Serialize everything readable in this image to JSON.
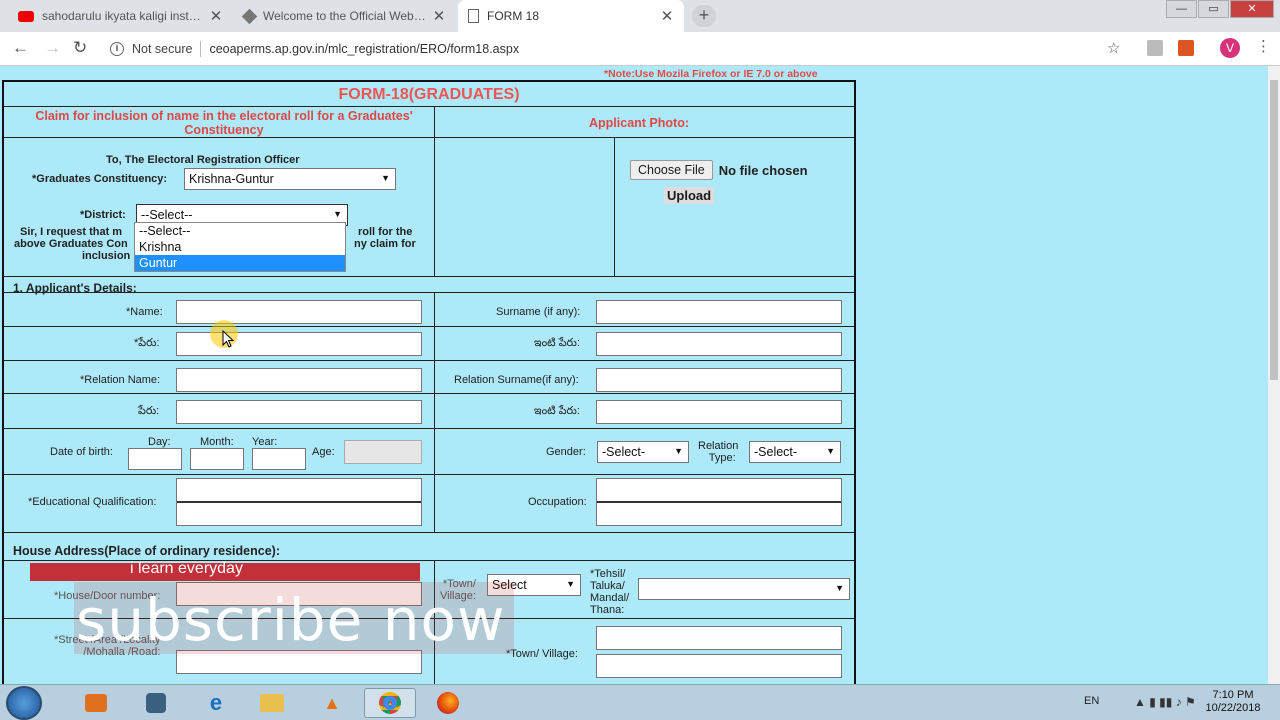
{
  "browser": {
    "tabs": [
      {
        "title": "sahodarulu ikyata kaligi instrume",
        "active": false
      },
      {
        "title": "Welcome to the Official Website",
        "active": false
      },
      {
        "title": "FORM 18",
        "active": true
      }
    ],
    "not_secure": "Not secure",
    "url": "ceoaperms.ap.gov.in/mlc_registration/ERO/form18.aspx",
    "profile_initial": "V"
  },
  "page": {
    "note": "*Note:Use Mozila Firefox or IE 7.0 or above",
    "form_title": "FORM-18(GRADUATES)",
    "claim_text": "Claim for inclusion of name in the electoral roll for a Graduates' Constituency",
    "photo_label": "Applicant Photo:",
    "choose_file": "Choose File",
    "no_file": "No file chosen",
    "upload": "Upload",
    "to_ero": "To, The Electoral Registration Officer",
    "constituency_label": "*Graduates Constituency:",
    "constituency_value": "Krishna-Guntur",
    "district_label": "*District:",
    "district_value": "--Select--",
    "district_options": [
      "--Select--",
      "Krishna",
      "Guntur"
    ],
    "request_text_1": "Sir, I request that m",
    "request_text_1b": "roll for the",
    "request_text_2": "above Graduates Con",
    "request_text_2b": "ny claim for",
    "request_text_3": "inclusion",
    "section_applicant": "1. Applicant's Details:",
    "name_label": "*Name:",
    "surname_label": "Surname (if any):",
    "name_te_label": "*పేరు:",
    "surname_te_label": "ఇంటి పేరు:",
    "relation_name_label": "*Relation Name:",
    "relation_surname_label": "Relation Surname(if any):",
    "rel_name_te_label": "పేరు:",
    "rel_surname_te_label": "ఇంటి పేరు:",
    "dob_label": "Date of birth:",
    "day": "Day:",
    "month": "Month:",
    "year": "Year:",
    "age": "Age:",
    "gender_label": "Gender:",
    "gender_value": "-Select-",
    "relation_type_label_1": "Relation",
    "relation_type_label_2": "Type:",
    "relation_type_value": "-Select-",
    "edu_label": "*Educational Qualification:",
    "occupation_label": "Occupation:",
    "house_address": "House Address(Place of ordinary residence):",
    "house_door_label": "*House/Door number:",
    "town_label_1": "*Town/",
    "town_label_2": "Village:",
    "town_select": "Select",
    "tehsil_1": "*Tehsil/",
    "tehsil_2": "Taluka/",
    "tehsil_3": "Mandal/",
    "tehsil_4": "Thana:",
    "street_1": "*Street /Area /Locality",
    "street_2": "/Mohalla /Road:",
    "town_village_label": "*Town/ Village:"
  },
  "overlay": {
    "learn": "i learn everyday",
    "subscribe": "subscribe now"
  },
  "taskbar": {
    "lang": "EN",
    "time": "7:10 PM",
    "date": "10/22/2018"
  }
}
